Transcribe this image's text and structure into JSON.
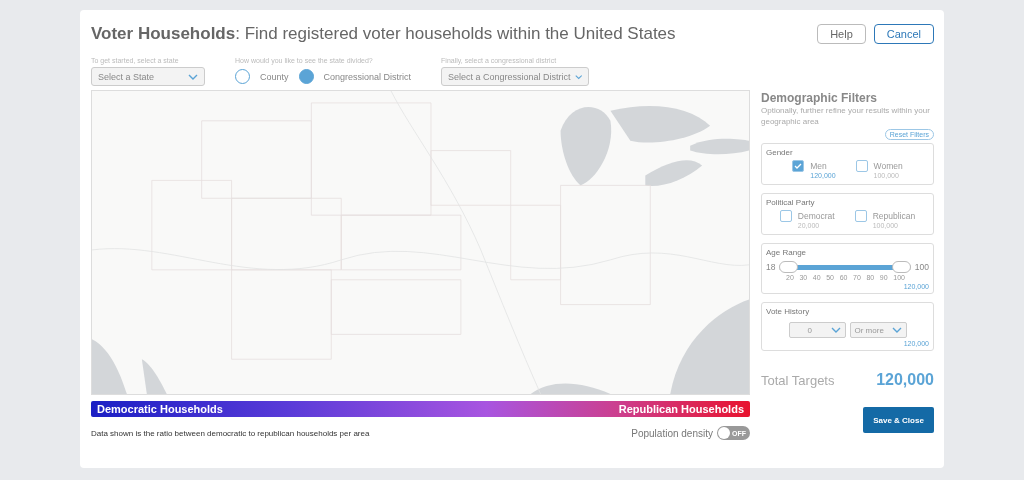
{
  "title": {
    "bold": "Voter Households",
    "rest": ": Find registered voter households within the United States"
  },
  "header_buttons": [
    {
      "label": "Help",
      "kind": "plain"
    },
    {
      "label": "Cancel",
      "kind": "outlined"
    }
  ],
  "state_select": {
    "caption": "To get started, select a state",
    "placeholder": "Select a State"
  },
  "division": {
    "caption": "How would you like to see the state divided?",
    "options": [
      {
        "label": "County",
        "selected": false
      },
      {
        "label": "Congressional District",
        "selected": true
      }
    ]
  },
  "district_select": {
    "caption": "Finally, select a congressional district",
    "placeholder": "Select a Congressional District"
  },
  "legend": {
    "left": "Democratic Households",
    "right": "Republican Households"
  },
  "note": "Data shown is the ratio between democratic to republican households per area",
  "population_density": {
    "label": "Population density",
    "on": false,
    "state_label": "OFF"
  },
  "filters": {
    "title": "Demographic Filters",
    "subtitle": "Optionally, further refine your results within your geographic area",
    "reset": "Reset Filters",
    "gender": {
      "title": "Gender",
      "options": [
        {
          "label": "Men",
          "count": "120,000",
          "checked": true
        },
        {
          "label": "Women",
          "count": "100,000",
          "checked": false
        }
      ]
    },
    "party": {
      "title": "Political Party",
      "options": [
        {
          "label": "Democrat",
          "count": "20,000",
          "checked": false
        },
        {
          "label": "Republican",
          "count": "100,000",
          "checked": false
        }
      ]
    },
    "age": {
      "title": "Age Range",
      "min": "18",
      "max": "100",
      "handles": [
        {
          "level": 0
        },
        {
          "level": 1
        }
      ],
      "ticks": [
        "20",
        "30",
        "40",
        "50",
        "60",
        "70",
        "80",
        "90",
        "100"
      ],
      "count": "120,000"
    },
    "vote_history": {
      "title": "Vote History",
      "selects": [
        "0",
        "Or more"
      ],
      "count": "120,000"
    }
  },
  "total": {
    "label": "Total Targets",
    "value": "120,000"
  },
  "save": "Save & Close"
}
